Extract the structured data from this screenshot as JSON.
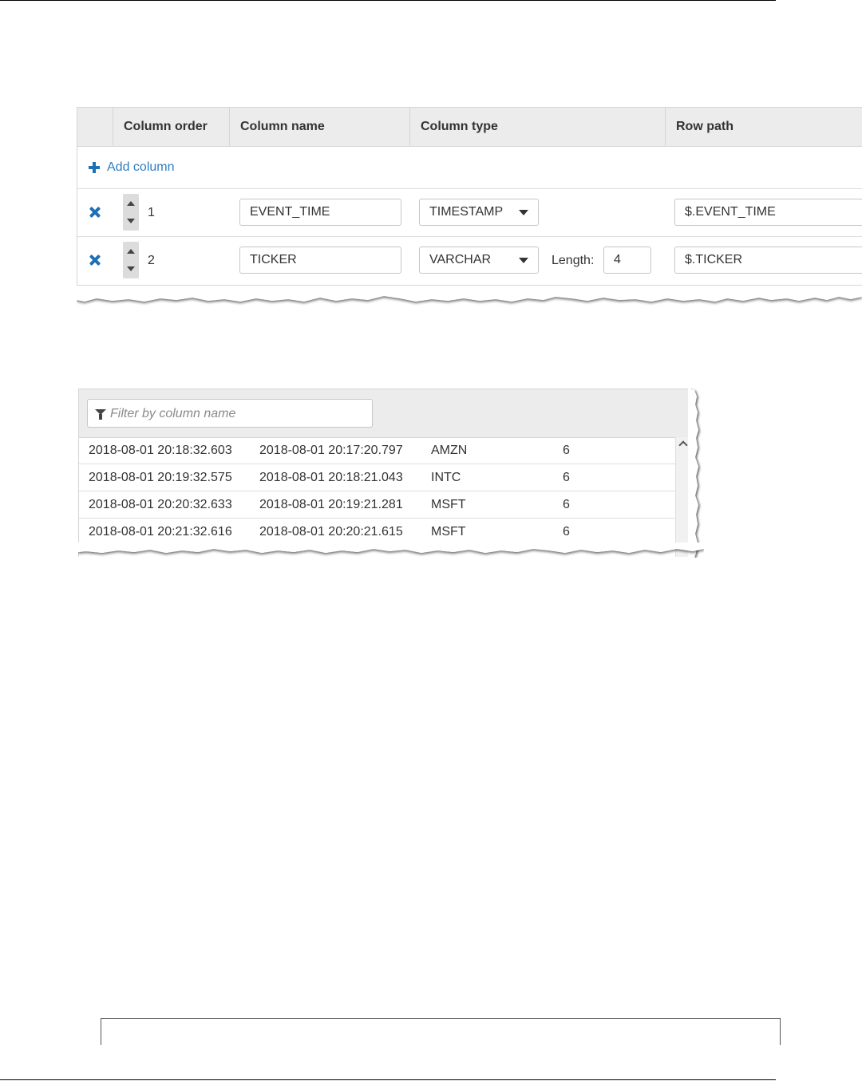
{
  "editor": {
    "headers": [
      "Column order",
      "Column name",
      "Column type",
      "Row path"
    ],
    "add_column_label": "Add column",
    "rows": [
      {
        "order": "1",
        "name": "EVENT_TIME",
        "type": "TIMESTAMP",
        "length_label": "",
        "length": "",
        "row_path": "$.EVENT_TIME"
      },
      {
        "order": "2",
        "name": "TICKER",
        "type": "VARCHAR",
        "length_label": "Length:",
        "length": "4",
        "row_path": "$.TICKER"
      }
    ]
  },
  "preview": {
    "filter_placeholder": "Filter by column name",
    "rows": [
      [
        "2018-08-01 20:18:32.603",
        "2018-08-01 20:17:20.797",
        "AMZN",
        "6"
      ],
      [
        "2018-08-01 20:19:32.575",
        "2018-08-01 20:18:21.043",
        "INTC",
        "6"
      ],
      [
        "2018-08-01 20:20:32.633",
        "2018-08-01 20:19:21.281",
        "MSFT",
        "6"
      ],
      [
        "2018-08-01 20:21:32.616",
        "2018-08-01 20:20:21.615",
        "MSFT",
        "6"
      ]
    ]
  },
  "icons": {
    "add": "plus-icon",
    "delete": "x-icon",
    "reorder": "up-down-arrows-icon",
    "dropdown": "caret-down-icon",
    "filter": "funnel-icon",
    "scroll": "chevron-up-icon"
  },
  "colors": {
    "accent": "#1f6fb5",
    "link": "#2f7dc4",
    "header_bg": "#ececec",
    "border": "#d5d5d5"
  }
}
